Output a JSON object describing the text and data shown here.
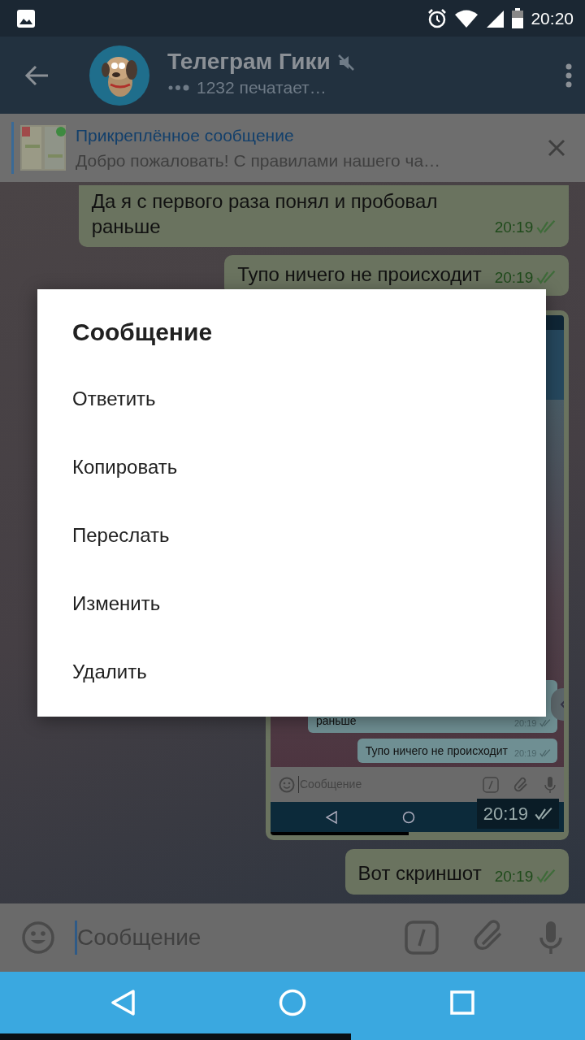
{
  "status_bar": {
    "time": "20:20"
  },
  "header": {
    "title": "Телеграм Гики",
    "muted": true,
    "subtitle": "1232 печатает…"
  },
  "pinned": {
    "title": "Прикреплённое сообщение",
    "text": "Добро пожаловать! С правилами нашего ча…"
  },
  "messages": [
    {
      "kind": "text",
      "text": "Да я с первого раза понял и пробовал раньше",
      "time": "20:19",
      "read": true
    },
    {
      "kind": "text",
      "text": "Тупо ничего не происходит",
      "time": "20:19",
      "read": true
    },
    {
      "kind": "screenshot",
      "messages": [
        {
          "text": "раньше",
          "time": "20:19",
          "read": true
        },
        {
          "text": "Тупо ничего не происходит",
          "time": "20:19",
          "read": true
        }
      ],
      "placeholder": "Сообщение",
      "time": "20:19",
      "read": true
    },
    {
      "kind": "text",
      "text": "Вот скриншот",
      "time": "20:19",
      "read": true
    }
  ],
  "composer": {
    "placeholder": "Сообщение"
  },
  "dialog": {
    "title": "Сообщение",
    "items": [
      "Ответить",
      "Копировать",
      "Переслать",
      "Изменить",
      "Удалить"
    ]
  }
}
